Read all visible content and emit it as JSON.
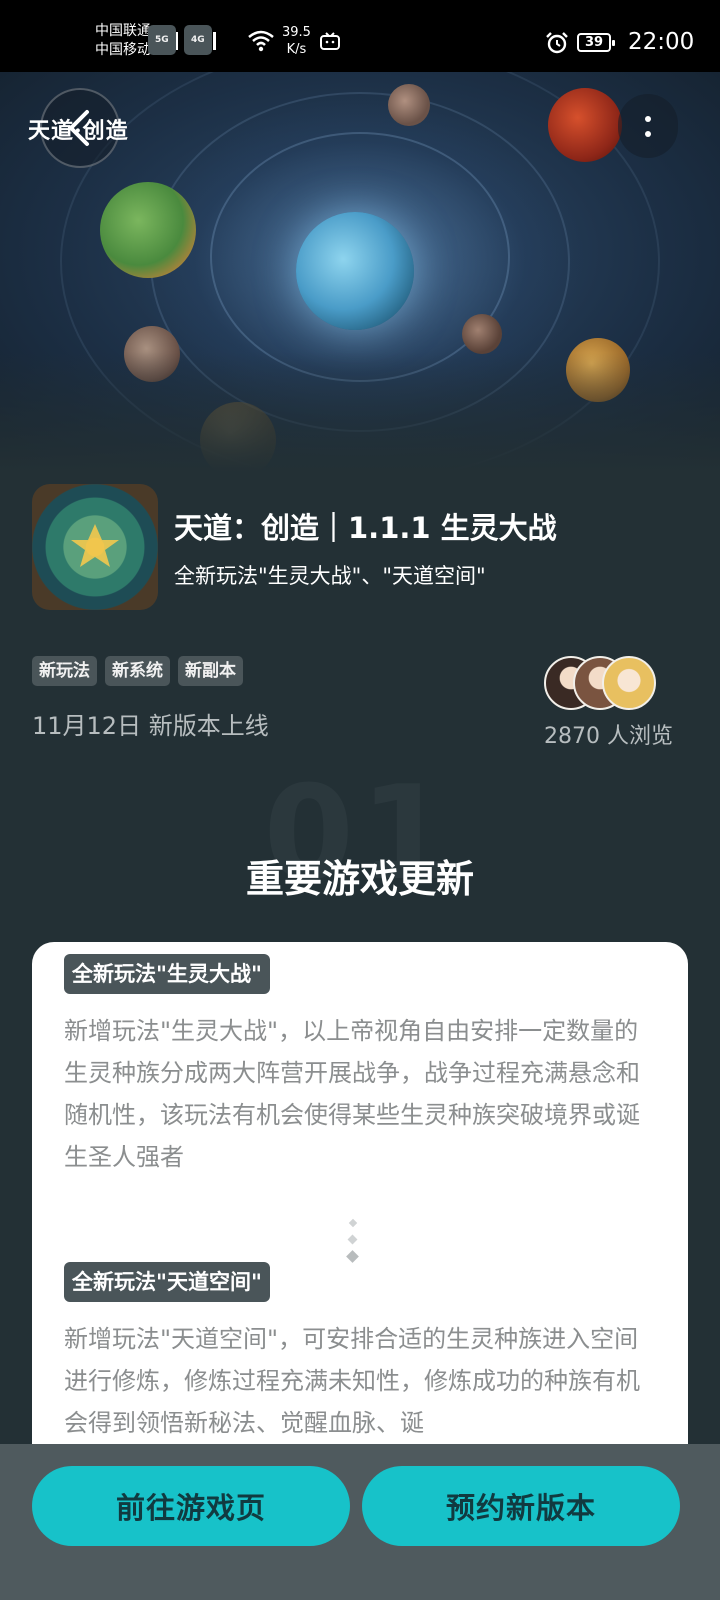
{
  "status_bar": {
    "carrier_1": "中国联通",
    "carrier_2": "中国移动",
    "net_1": "5G",
    "net_2": "4G",
    "speed_value": "39.5",
    "speed_unit": "K/s",
    "battery": "39",
    "time": "22:00"
  },
  "hero": {
    "logo_text": "天道·创造",
    "back_icon": "chevron-left-icon",
    "more_icon": "more-vertical-icon"
  },
  "game": {
    "title": "天道：创造｜1.1.1 生灵大战",
    "subtitle": "全新玩法\"生灵大战\"、\"天道空间\"",
    "tags": [
      "新玩法",
      "新系统",
      "新副本"
    ],
    "release_date": "11月12日 新版本上线",
    "views": "2870 人浏览"
  },
  "section": {
    "number": "01",
    "title": "重要游戏更新",
    "features": [
      {
        "label": "全新玩法\"生灵大战\"",
        "text": "新增玩法\"生灵大战\"，以上帝视角自由安排一定数量的生灵种族分成两大阵营开展战争，战争过程充满悬念和随机性，该玩法有机会使得某些生灵种族突破境界或诞生圣人强者"
      },
      {
        "label": "全新玩法\"天道空间\"",
        "text": "新增玩法\"天道空间\"，可安排合适的生灵种族进入空间进行修炼，修炼过程充满未知性，修炼成功的种族有机会得到领悟新秘法、觉醒血脉、诞"
      }
    ]
  },
  "actions": {
    "goto_game": "前往游戏页",
    "reserve": "预约新版本"
  },
  "colors": {
    "background": "#233035",
    "accent": "#17c2c9",
    "tag_bg": "#4a5559"
  }
}
